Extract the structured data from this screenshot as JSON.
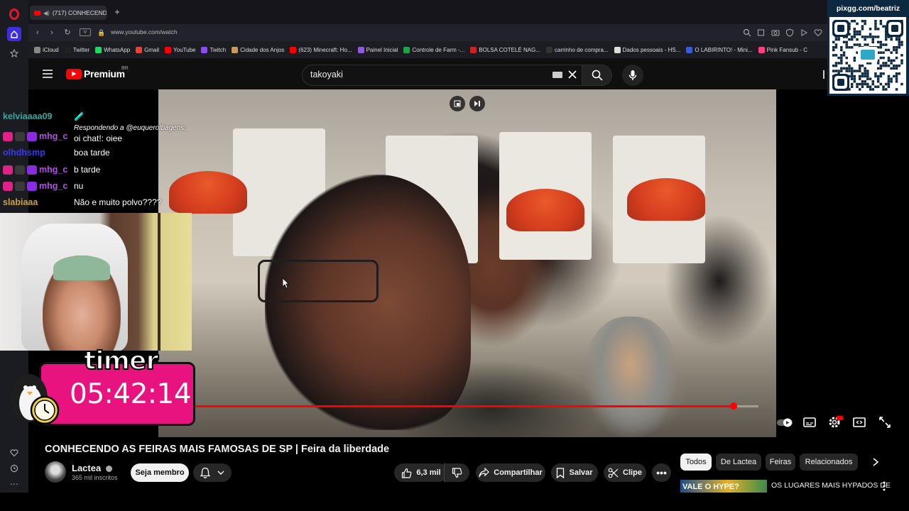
{
  "browser": {
    "tab_title": "(717) CONHECENDO",
    "new_tab_symbol": "+",
    "url": "www.youtube.com/watch",
    "bookmarks": [
      {
        "label": "iCloud",
        "color": "#888888"
      },
      {
        "label": "Twitter",
        "color": "#222222"
      },
      {
        "label": "WhatsApp",
        "color": "#25d366"
      },
      {
        "label": "Gmail",
        "color": "#ea4335"
      },
      {
        "label": "YouTube",
        "color": "#ff0000"
      },
      {
        "label": "Twitch",
        "color": "#9146ff"
      },
      {
        "label": "Cidade dos Anjos",
        "color": "#c79a5a"
      },
      {
        "label": "(623) Minecraft: Ho...",
        "color": "#ff0000"
      },
      {
        "label": "Painel Inicial",
        "color": "#8e5cd9"
      },
      {
        "label": "Controle de Farm -...",
        "color": "#1ea34a"
      },
      {
        "label": "BOLSA COTELÉ NAG...",
        "color": "#cc2222"
      },
      {
        "label": "carrinho de compra...",
        "color": "#333333"
      },
      {
        "label": "Dados pessoais - HS...",
        "color": "#dddddd"
      },
      {
        "label": "O LABIRINTO! - Mini...",
        "color": "#3b5bdb"
      },
      {
        "label": "Pink Fansub - C",
        "color": "#ff3f7f"
      }
    ]
  },
  "youtube": {
    "logo_text": "Premium",
    "region": "BR",
    "search_query": "takoyaki",
    "video_title": "CONHECENDO AS FEIRAS MAIS FAMOSAS DE SP | Feira da liberdade",
    "channel_name": "Lactea",
    "subscribers": "365 mil inscritos",
    "join_label": "Seja membro",
    "likes": "6,3 mil",
    "share_label": "Compartilhar",
    "save_label": "Salvar",
    "clip_label": "Clipe",
    "chips": [
      "Todos",
      "De Lactea",
      "Feiras",
      "Relacionados"
    ],
    "rec_thumb_text": "VALE O HYPE?",
    "rec_title": "OS LUGARES MAIS HYPADOS DE",
    "progress": 0.98
  },
  "chat": [
    {
      "user": "kelviaaaa09",
      "color": "#2fa8a0",
      "badges": 0,
      "message": "🧪",
      "reply": ""
    },
    {
      "user": "mhg_c",
      "color": "#b64ce6",
      "badges": 3,
      "message": "oi chat!: oiee",
      "reply": "Respondendo a @euquerolbagens:"
    },
    {
      "user": "olhdhsmp",
      "color": "#3a3ae6",
      "badges": 0,
      "message": "boa tarde",
      "reply": ""
    },
    {
      "user": "mhg_c",
      "color": "#b64ce6",
      "badges": 3,
      "message": "b tarde",
      "reply": ""
    },
    {
      "user": "mhg_c",
      "color": "#b64ce6",
      "badges": 3,
      "message": "nu",
      "reply": ""
    },
    {
      "user": "slabiaaa",
      "color": "#c8a046",
      "badges": 0,
      "message": "Não e muito polvo????",
      "reply": ""
    }
  ],
  "overlay": {
    "timer_label": "timer",
    "timer_value": "05:42:14",
    "qr_label": "pixgg.com/beatriz"
  },
  "colors": {
    "accent_red": "#ff0000",
    "timer_pink": "#e8137e",
    "qr_bg": "#0d2942"
  }
}
